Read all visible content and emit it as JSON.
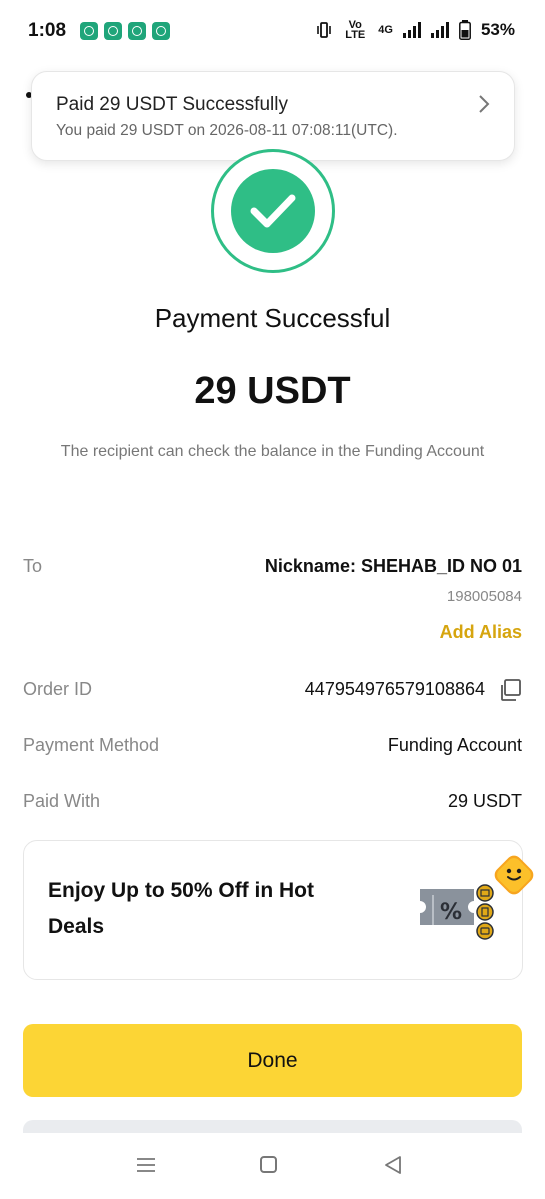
{
  "status_bar": {
    "time": "1:08",
    "network_label": "Vo LTE",
    "network_4g": "4G",
    "battery": "53%"
  },
  "notification": {
    "title": "Paid 29 USDT Successfully",
    "subtitle": "You paid 29 USDT on 2026-08-11 07:08:11(UTC)."
  },
  "payment": {
    "title": "Payment Successful",
    "amount": "29 USDT",
    "note": "The recipient can check the balance in the Funding Account"
  },
  "details": {
    "to_label": "To",
    "nickname": "Nickname: SHEHAB_ID NO 01",
    "uid": "198005084",
    "add_alias": "Add Alias",
    "order_id_label": "Order ID",
    "order_id": "447954976579108864",
    "payment_method_label": "Payment Method",
    "payment_method": "Funding Account",
    "paid_with_label": "Paid With",
    "paid_with": "29 USDT"
  },
  "promo": {
    "text": "Enjoy Up to 50% Off in Hot Deals"
  },
  "actions": {
    "done": "Done"
  },
  "colors": {
    "accent_yellow": "#fcd535",
    "success_green": "#2fbe86",
    "alias_gold": "#d6a50f"
  }
}
